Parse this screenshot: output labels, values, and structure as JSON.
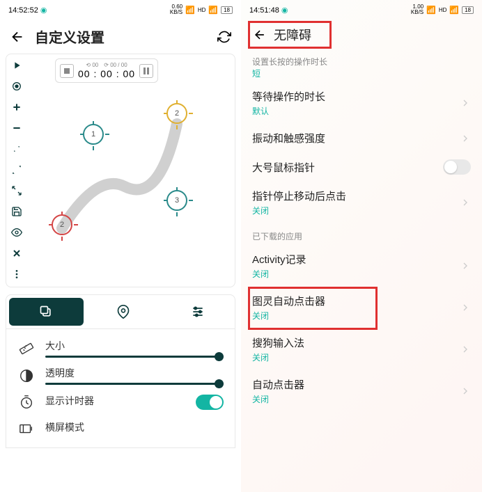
{
  "left": {
    "status": {
      "time": "14:52:52",
      "kbs": "0.60",
      "kbs_unit": "KB/S",
      "battery": "18"
    },
    "header": {
      "title": "自定义设置"
    },
    "timer": {
      "loop1": "00",
      "loop2": "00 / 00",
      "main": "00 : 00 : 00"
    },
    "targets": {
      "t1": "1",
      "t2": "2",
      "t3": "2",
      "t4": "3"
    },
    "settings": {
      "size": "大小",
      "opacity": "透明度",
      "show_timer": "显示计时器",
      "landscape": "横屏模式"
    }
  },
  "right": {
    "status": {
      "time": "14:51:48",
      "kbs": "1.00",
      "kbs_unit": "KB/S",
      "battery": "18"
    },
    "header": {
      "title": "无障碍"
    },
    "section1": {
      "title": "设置长按的操作时长",
      "sub": "短"
    },
    "items": {
      "wait": {
        "title": "等待操作的时长",
        "sub": "默认"
      },
      "vibration": {
        "title": "振动和触感强度"
      },
      "large_cursor": {
        "title": "大号鼠标指针"
      },
      "click_after_stop": {
        "title": "指针停止移动后点击",
        "sub": "关闭"
      }
    },
    "section2": "已下载的应用",
    "apps": {
      "activity": {
        "title": "Activity记录",
        "sub": "关闭"
      },
      "tuling": {
        "title": "图灵自动点击器",
        "sub": "关闭"
      },
      "sogou": {
        "title": "搜狗输入法",
        "sub": "关闭"
      },
      "auto_clicker": {
        "title": "自动点击器",
        "sub": "关闭"
      }
    }
  }
}
